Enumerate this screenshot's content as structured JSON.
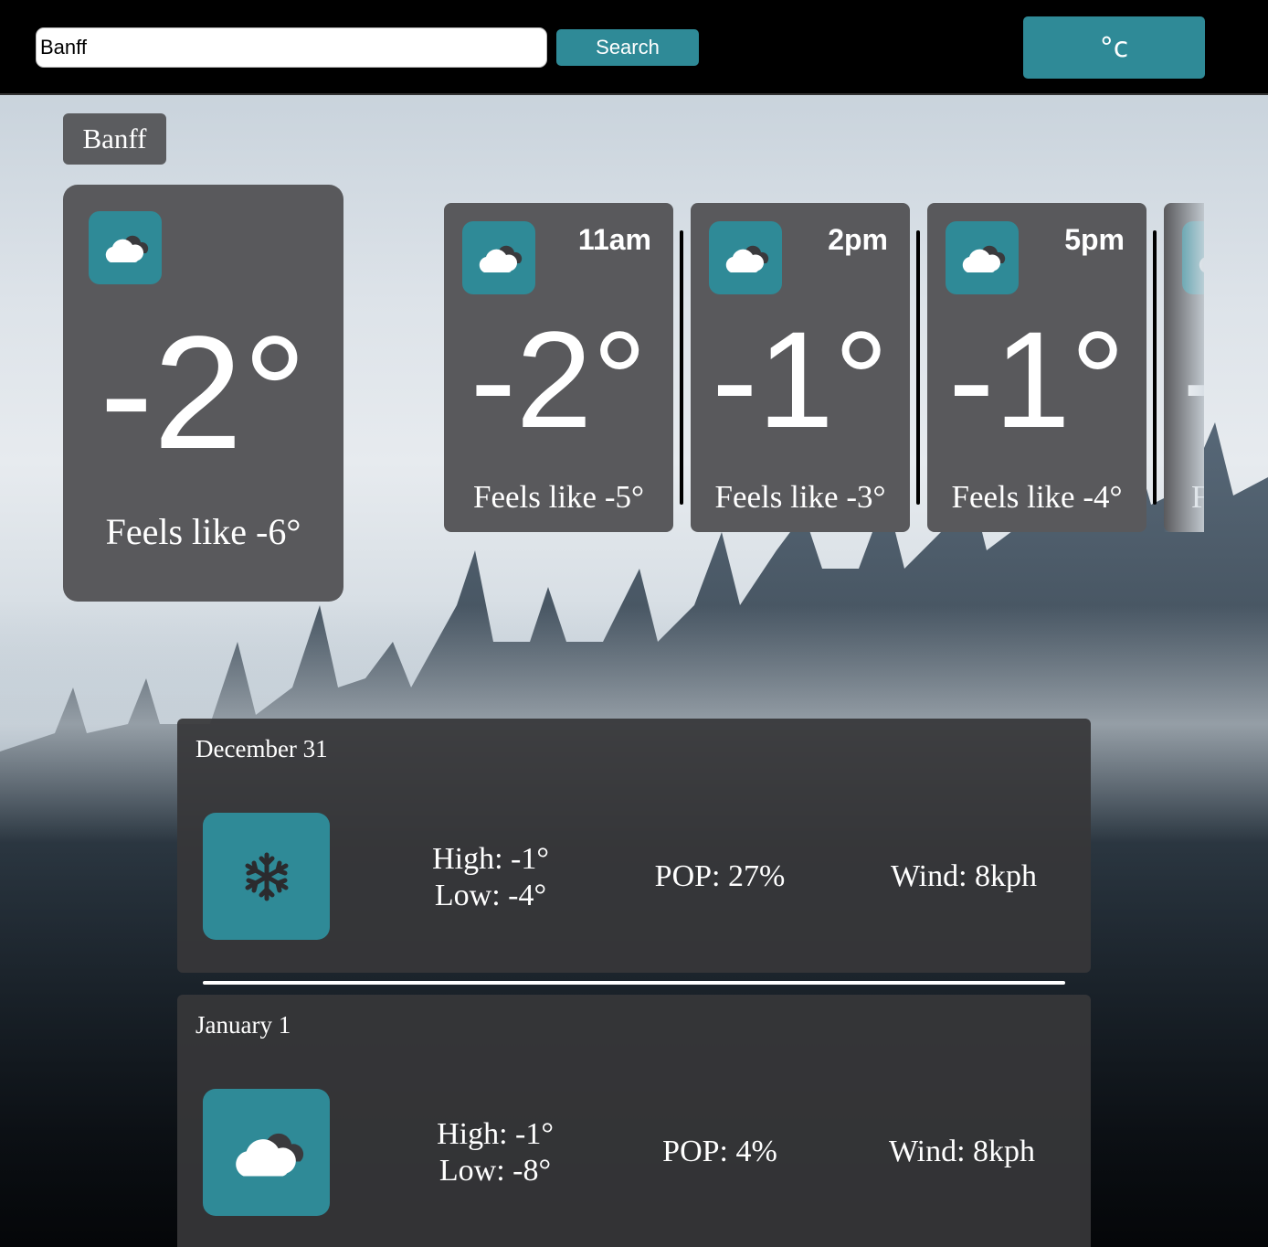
{
  "search": {
    "value": "Banff",
    "button_label": "Search"
  },
  "unit_toggle": {
    "label": "°c"
  },
  "location": {
    "name": "Banff"
  },
  "current": {
    "icon": "cloudy-icon",
    "temp": "-2°",
    "feels_like": "Feels like -6°"
  },
  "hourly": [
    {
      "time": "11am",
      "icon": "cloudy-icon",
      "temp": "-2°",
      "feels_like": "Feels like -5°"
    },
    {
      "time": "2pm",
      "icon": "cloudy-icon",
      "temp": "-1°",
      "feels_like": "Feels like -3°"
    },
    {
      "time": "5pm",
      "icon": "cloudy-icon",
      "temp": "-1°",
      "feels_like": "Feels like -4°"
    },
    {
      "time": "",
      "icon": "cloudy-icon",
      "temp": "-",
      "feels_like": "F"
    }
  ],
  "daily": [
    {
      "date": "December 31",
      "icon": "snowflake-icon",
      "high": "High: -1°",
      "low": "Low: -4°",
      "pop": "POP: 27%",
      "wind": "Wind: 8kph"
    },
    {
      "date": "January 1",
      "icon": "cloudy-icon",
      "high": "High: -1°",
      "low": "Low: -8°",
      "pop": "POP: 4%",
      "wind": "Wind: 8kph"
    }
  ],
  "colors": {
    "accent": "#2f8a97",
    "card": "#59595c",
    "day_card": "#373739"
  }
}
